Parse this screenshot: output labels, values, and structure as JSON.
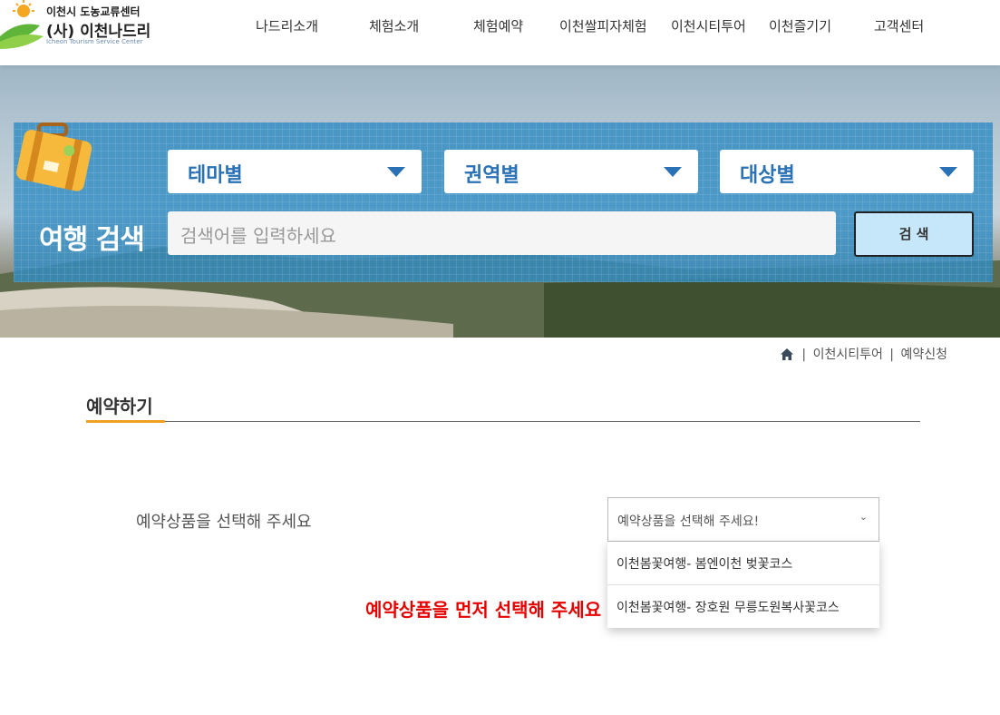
{
  "header": {
    "logo": {
      "line1": "이천시 도농교류센터",
      "line2": "(사) 이천나드리",
      "line3": "Icheon Tourism Service Center"
    },
    "nav": [
      "나드리소개",
      "체험소개",
      "체험예약",
      "이천쌀피자체험",
      "이천시티투어",
      "이천즐기기",
      "고객센터"
    ]
  },
  "search": {
    "title": "여행 검색",
    "selects": [
      "테마별",
      "권역별",
      "대상별"
    ],
    "placeholder": "검색어를 입력하세요",
    "button_label": "검 색"
  },
  "breadcrumb": {
    "home_icon": "home-icon",
    "items": [
      "이천시티투어",
      "예약신청"
    ]
  },
  "section": {
    "title": "예약하기"
  },
  "reservation": {
    "label": "예약상품을 선택해 주세요",
    "select_value": "예약상품을 선택해 주세요!",
    "options": [
      "이천봄꽃여행- 봄엔이천 벚꽃코스",
      "이천봄꽃여행- 장호원 무릉도원복사꽃코스"
    ],
    "notice": "예약상품을 먼저 선택해 주세요"
  },
  "colors": {
    "accent": "#f0a020",
    "panel_blue": "#328cc3",
    "select_text": "#2a72b5",
    "notice_red": "#e60000"
  }
}
